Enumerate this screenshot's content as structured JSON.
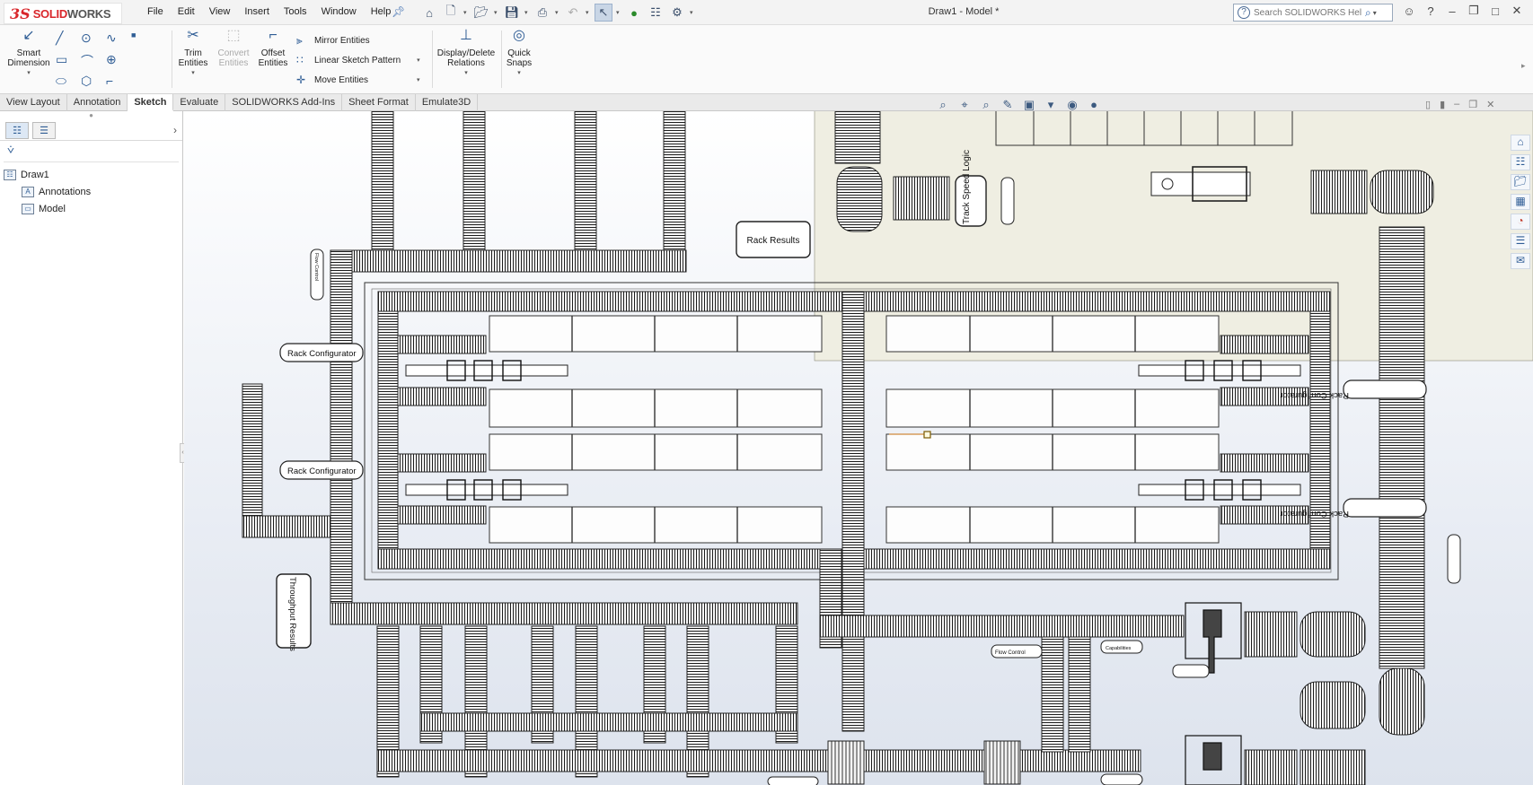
{
  "app": {
    "logo_ds": "3S",
    "logo_name_a": "SOLID",
    "logo_name_b": "WORKS",
    "doc_title": "Draw1 - Model *"
  },
  "menus": [
    "File",
    "Edit",
    "View",
    "Insert",
    "Tools",
    "Window",
    "Help"
  ],
  "search": {
    "placeholder": "Search SOLIDWORKS Help"
  },
  "toolbar": {
    "smart_dimension": "Smart Dimension",
    "trim_entities": "Trim Entities",
    "convert_entities": "Convert Entities",
    "offset_entities": "Offset Entities",
    "mirror_entities": "Mirror Entities",
    "linear_sketch_pattern": "Linear Sketch Pattern",
    "move_entities": "Move Entities",
    "display_delete_relations": "Display/Delete Relations",
    "quick_snaps": "Quick Snaps"
  },
  "tabs": [
    "View Layout",
    "Annotation",
    "Sketch",
    "Evaluate",
    "SOLIDWORKS Add-Ins",
    "Sheet Format",
    "Emulate3D"
  ],
  "active_tab": "Sketch",
  "tree": {
    "root": "Draw1",
    "children": [
      "Annotations",
      "Model"
    ]
  },
  "drawing_labels": {
    "rack_results": "Rack Results",
    "rack_config_1": "Rack Configurator",
    "rack_config_2": "Rack Configurator",
    "rack_config_3": "Rack Configurator",
    "rack_config_4": "Rack Configurator",
    "throughput_results": "Throughput Results",
    "track_speed_logic": "Track Speed Logic",
    "flow_control": "Flow Control",
    "capabilities": "Capabilities"
  },
  "icons": {
    "home": "home-icon",
    "new": "new-file-icon",
    "open": "open-folder-icon",
    "save": "save-icon",
    "print": "print-icon",
    "undo": "undo-icon",
    "select": "select-arrow-icon",
    "rebuild": "traffic-light-icon",
    "options": "gear-icon"
  }
}
